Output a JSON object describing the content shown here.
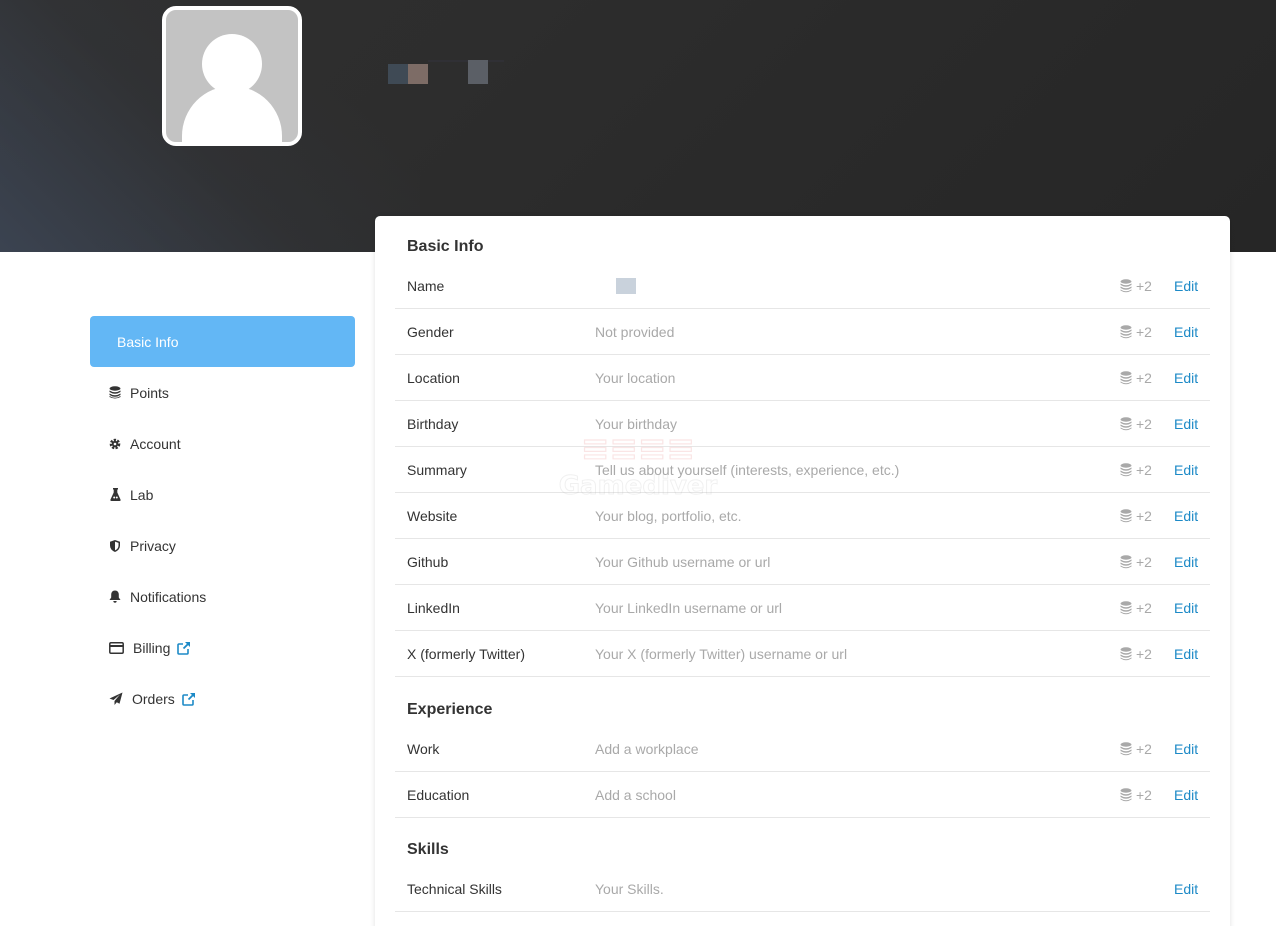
{
  "sidebar": {
    "items": [
      {
        "label": "Basic Info",
        "icon": "",
        "active": true
      },
      {
        "label": "Points",
        "icon": "coins-icon"
      },
      {
        "label": "Account",
        "icon": "gear-icon"
      },
      {
        "label": "Lab",
        "icon": "flask-icon"
      },
      {
        "label": "Privacy",
        "icon": "shield-icon"
      },
      {
        "label": "Notifications",
        "icon": "bell-icon"
      },
      {
        "label": "Billing",
        "icon": "credit-card-icon",
        "external": true
      },
      {
        "label": "Orders",
        "icon": "paper-plane-icon",
        "external": true
      }
    ]
  },
  "basic_info": {
    "title": "Basic Info",
    "rows": [
      {
        "label": "Name",
        "value": "",
        "points": "+2",
        "edit": "Edit"
      },
      {
        "label": "Gender",
        "value": "Not provided",
        "points": "+2",
        "edit": "Edit"
      },
      {
        "label": "Location",
        "value": "Your location",
        "points": "+2",
        "edit": "Edit"
      },
      {
        "label": "Birthday",
        "value": "Your birthday",
        "points": "+2",
        "edit": "Edit"
      },
      {
        "label": "Summary",
        "value": "Tell us about yourself (interests, experience, etc.)",
        "points": "+2",
        "edit": "Edit"
      },
      {
        "label": "Website",
        "value": "Your blog, portfolio, etc.",
        "points": "+2",
        "edit": "Edit"
      },
      {
        "label": "Github",
        "value": "Your Github username or url",
        "points": "+2",
        "edit": "Edit"
      },
      {
        "label": "LinkedIn",
        "value": "Your LinkedIn username or url",
        "points": "+2",
        "edit": "Edit"
      },
      {
        "label": "X (formerly Twitter)",
        "value": "Your X (formerly Twitter) username or url",
        "points": "+2",
        "edit": "Edit"
      }
    ]
  },
  "experience": {
    "title": "Experience",
    "rows": [
      {
        "label": "Work",
        "value": "Add a workplace",
        "points": "+2",
        "edit": "Edit"
      },
      {
        "label": "Education",
        "value": "Add a school",
        "points": "+2",
        "edit": "Edit"
      }
    ]
  },
  "skills": {
    "title": "Skills",
    "rows": [
      {
        "label": "Technical Skills",
        "value": "Your Skills.",
        "edit": "Edit"
      }
    ]
  },
  "colors": {
    "accent": "#63b7f5",
    "link": "#1d8ac7",
    "banner": "#2b2b2b"
  }
}
